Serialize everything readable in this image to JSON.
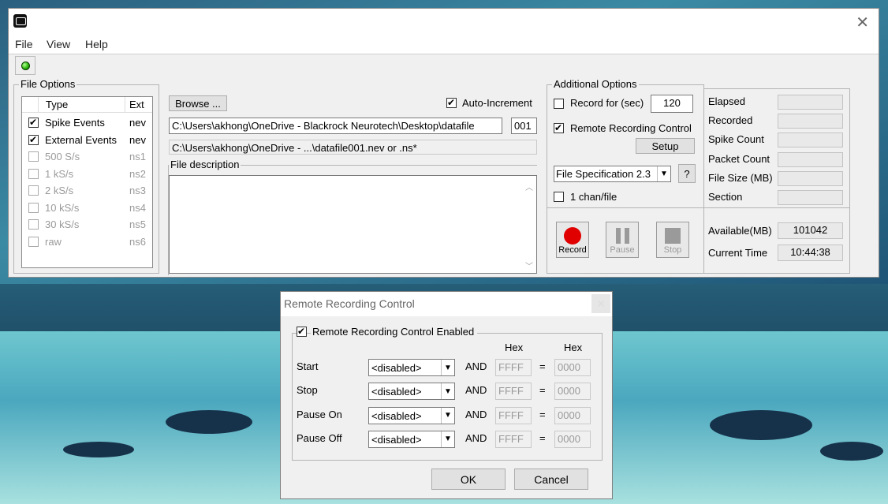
{
  "window": {
    "menu": [
      "File",
      "View",
      "Help"
    ]
  },
  "file_options": {
    "title": "File Options",
    "col_type": "Type",
    "col_ext": "Ext",
    "rows": [
      {
        "type": "Spike Events",
        "ext": "nev",
        "checked": true,
        "enabled": true
      },
      {
        "type": "External Events",
        "ext": "nev",
        "checked": true,
        "enabled": true
      },
      {
        "type": "500 S/s",
        "ext": "ns1",
        "checked": false,
        "enabled": false
      },
      {
        "type": "1 kS/s",
        "ext": "ns2",
        "checked": false,
        "enabled": false
      },
      {
        "type": "2 kS/s",
        "ext": "ns3",
        "checked": false,
        "enabled": false
      },
      {
        "type": "10 kS/s",
        "ext": "ns4",
        "checked": false,
        "enabled": false
      },
      {
        "type": "30 kS/s",
        "ext": "ns5",
        "checked": false,
        "enabled": false
      },
      {
        "type": "raw",
        "ext": "ns6",
        "checked": false,
        "enabled": false
      }
    ]
  },
  "file_panel": {
    "browse": "Browse ...",
    "auto_increment": "Auto-Increment",
    "path": "C:\\Users\\akhong\\OneDrive - Blackrock Neurotech\\Desktop\\datafile",
    "index": "001",
    "resolved": "C:\\Users\\akhong\\OneDrive - ...\\datafile001.nev or .ns*",
    "description_label": "File description"
  },
  "additional": {
    "title": "Additional Options",
    "record_for": "Record for (sec)",
    "record_secs": "120",
    "remote_control": "Remote Recording Control",
    "setup": "Setup",
    "file_spec": "File Specification 2.3",
    "help": "?",
    "one_chan": "1 chan/file"
  },
  "controls": {
    "record": "Record",
    "pause": "Pause",
    "stop": "Stop"
  },
  "stats": {
    "labels": [
      "Elapsed",
      "Recorded",
      "Spike Count",
      "Packet Count",
      "File Size (MB)",
      "Section"
    ],
    "available_label": "Available(MB)",
    "available_value": "101042",
    "time_label": "Current Time",
    "time_value": "10:44:38"
  },
  "dialog": {
    "title": "Remote Recording Control",
    "enabled_label": "Remote Recording Control Enabled",
    "hex": "Hex",
    "and": "AND",
    "eq": "=",
    "rows": [
      {
        "label": "Start",
        "source": "<disabled>",
        "mask": "FFFF",
        "value": "0000"
      },
      {
        "label": "Stop",
        "source": "<disabled>",
        "mask": "FFFF",
        "value": "0000"
      },
      {
        "label": "Pause On",
        "source": "<disabled>",
        "mask": "FFFF",
        "value": "0000"
      },
      {
        "label": "Pause Off",
        "source": "<disabled>",
        "mask": "FFFF",
        "value": "0000"
      }
    ],
    "ok": "OK",
    "cancel": "Cancel"
  }
}
